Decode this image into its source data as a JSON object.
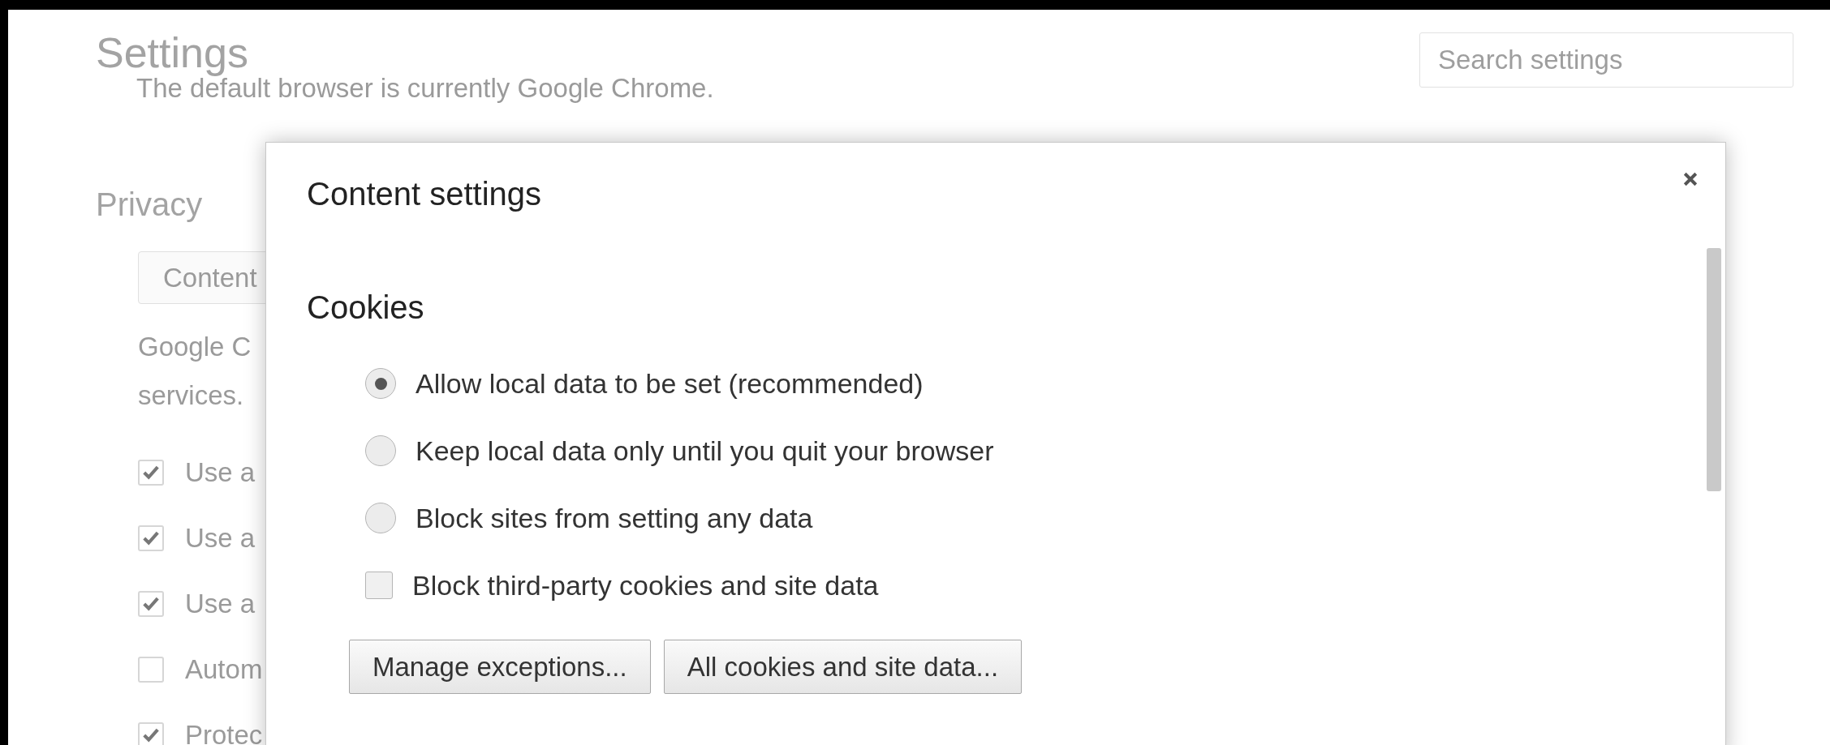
{
  "page": {
    "title": "Settings",
    "default_browser_text": "The default browser is currently Google Chrome.",
    "search": {
      "placeholder": "Search settings"
    },
    "privacy": {
      "heading": "Privacy",
      "button": "Content",
      "description_lines": [
        "Google C",
        "services."
      ],
      "checkboxes": [
        {
          "label": "Use a",
          "checked": true
        },
        {
          "label": "Use a",
          "checked": true
        },
        {
          "label": "Use a",
          "checked": true
        },
        {
          "label": "Autom",
          "checked": false
        },
        {
          "label": "Protec",
          "checked": true
        }
      ]
    }
  },
  "dialog": {
    "title": "Content settings",
    "section": "Cookies",
    "options": [
      {
        "label": "Allow local data to be set (recommended)",
        "selected": true
      },
      {
        "label": "Keep local data only until you quit your browser",
        "selected": false
      },
      {
        "label": "Block sites from setting any data",
        "selected": false
      }
    ],
    "third_party": {
      "label": "Block third-party cookies and site data",
      "checked": false
    },
    "buttons": [
      "Manage exceptions...",
      "All cookies and site data..."
    ]
  }
}
